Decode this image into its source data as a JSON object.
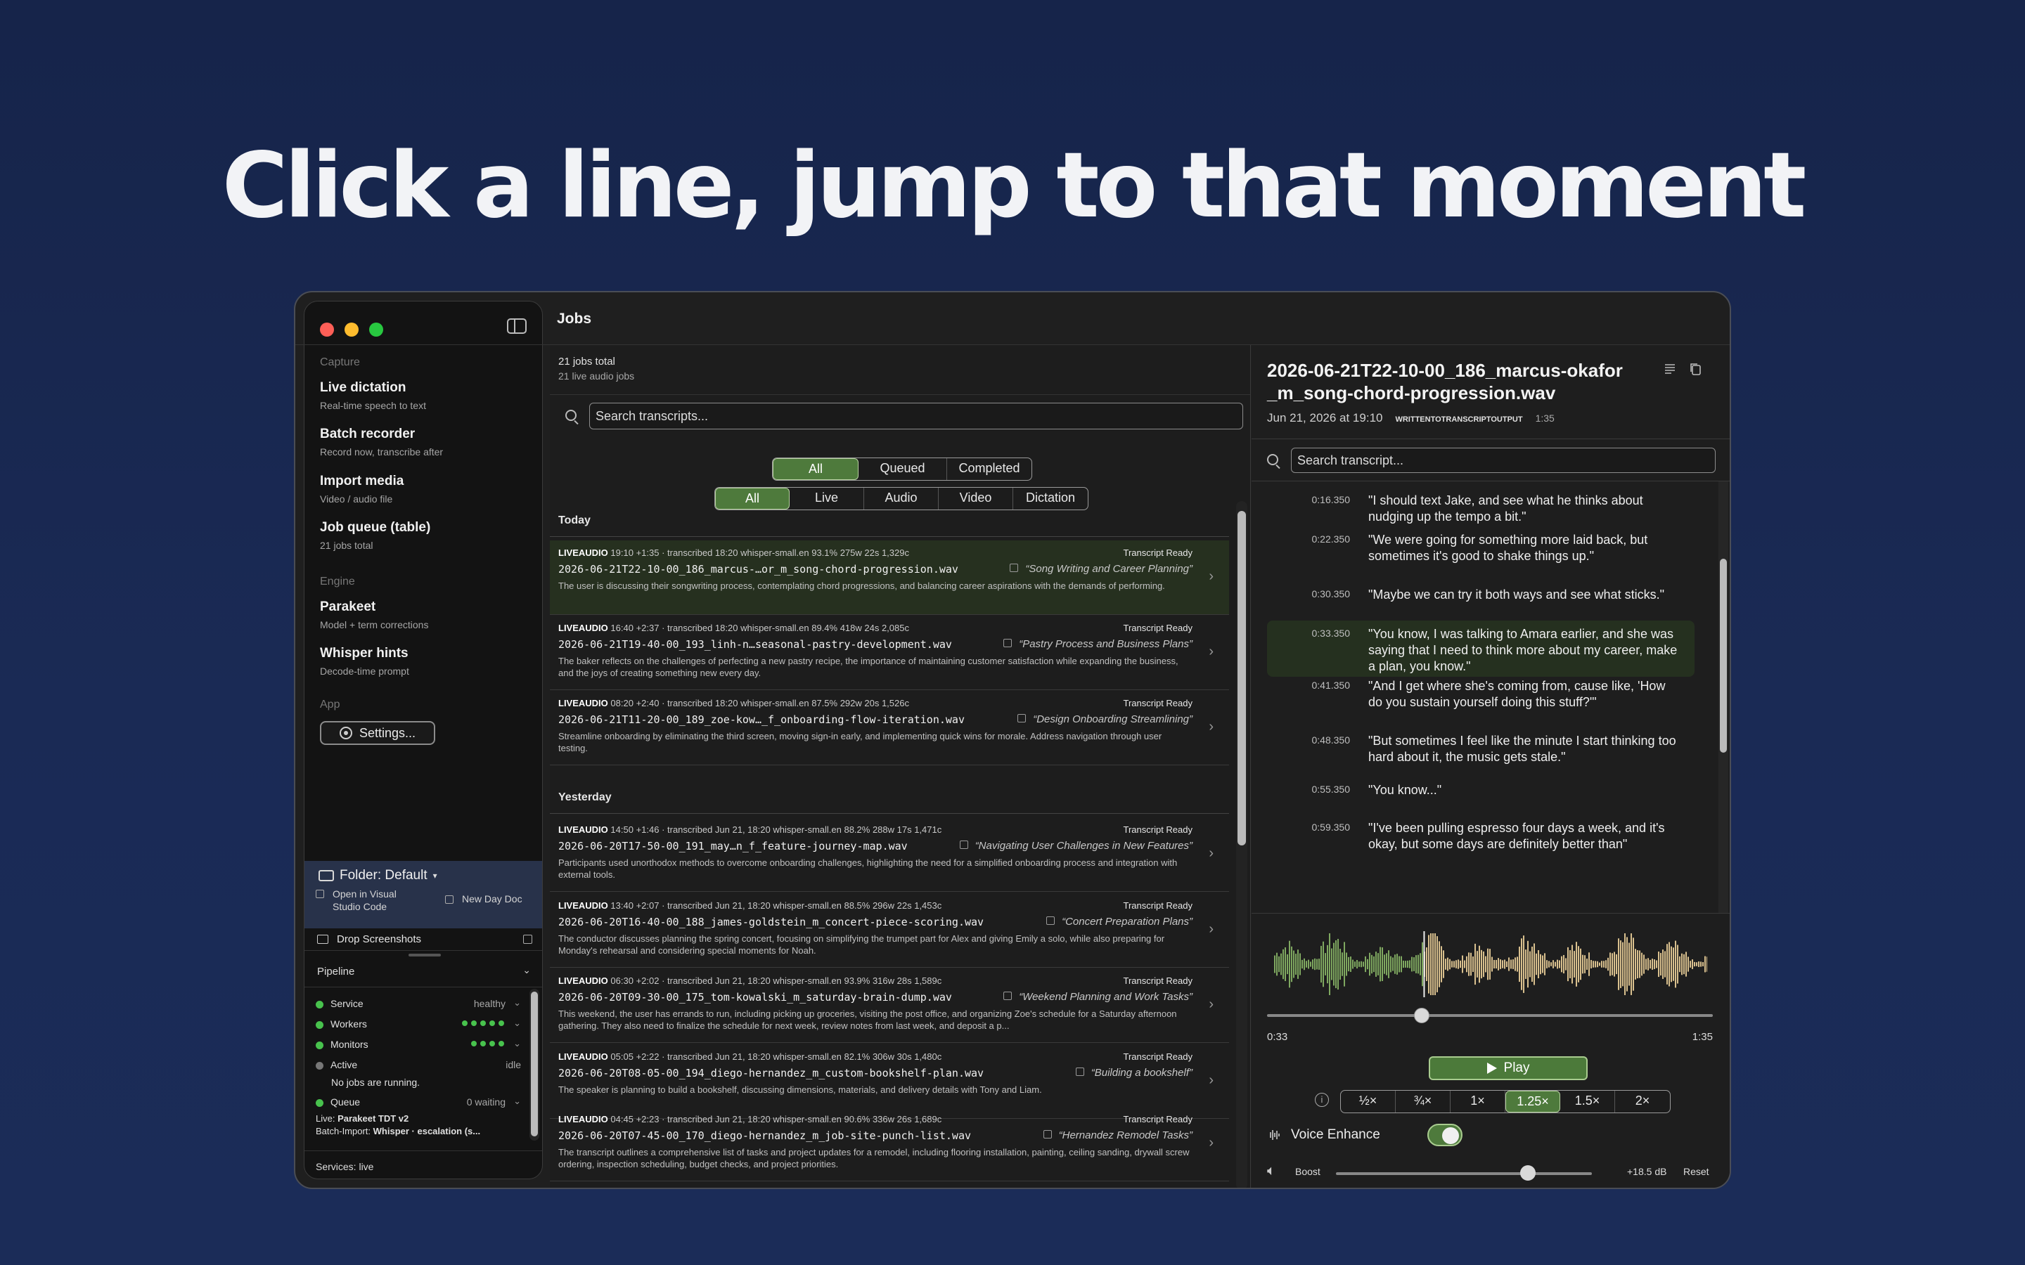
{
  "headline": "Click a line, jump to that moment",
  "sidebar": {
    "capture_head": "Capture",
    "items": [
      {
        "title": "Live dictation",
        "sub": "Real-time speech to text"
      },
      {
        "title": "Batch recorder",
        "sub": "Record now, transcribe after"
      },
      {
        "title": "Import media",
        "sub": "Video / audio file"
      },
      {
        "title": "Job queue (table)",
        "sub": "21 jobs total"
      },
      {
        "title": "Parakeet",
        "sub": "Model + term corrections"
      },
      {
        "title": "Whisper hints",
        "sub": "Decode-time prompt"
      }
    ],
    "engine_head": "Engine",
    "app_head": "App",
    "settings_label": "Settings...",
    "folder_label": "Folder: Default",
    "open_vs_label": "Open in Visual Studio Code",
    "new_day_doc": "New Day Doc",
    "drop_screenshots": "Drop Screenshots",
    "pipeline_head": "Pipeline",
    "pipeline": {
      "service": {
        "label": "Service",
        "value": "healthy"
      },
      "workers": {
        "label": "Workers"
      },
      "monitors": {
        "label": "Monitors"
      },
      "active": {
        "label": "Active",
        "value": "idle",
        "note": "No jobs are running."
      },
      "queue": {
        "label": "Queue",
        "value": "0 waiting"
      },
      "live": {
        "label": "Live:",
        "value": "Parakeet TDT v2"
      },
      "batch": {
        "label": "Batch-Import:",
        "value": "Whisper · escalation (s..."
      }
    },
    "services": "Services: live"
  },
  "toolbar": {
    "title": "Jobs"
  },
  "jobs": {
    "total": "21 jobs total",
    "live_total": "21 live audio jobs",
    "search_placeholder": "Search transcripts...",
    "status_filters": [
      "All",
      "Queued",
      "Completed"
    ],
    "type_filters": [
      "All",
      "Live",
      "Audio",
      "Video",
      "Dictation"
    ],
    "today_label": "Today",
    "yesterday_label": "Yesterday",
    "today": [
      {
        "kind": "LIVEAUDIO",
        "meta": "19:10 +1:35 · transcribed 18:20  whisper-small.en  93.1%  275w  22s  1,329c",
        "status": "Transcript Ready",
        "file": "2026-06-21T22-10-00_186_marcus-…or_m_song-chord-progression.wav",
        "topic": "“Song Writing and Career Planning”",
        "desc": "The user is discussing their songwriting process, contemplating chord progressions, and balancing career aspirations with the demands of performing."
      },
      {
        "kind": "LIVEAUDIO",
        "meta": "16:40 +2:37 · transcribed 18:20  whisper-small.en  89.4%  418w  24s  2,085c",
        "status": "Transcript Ready",
        "file": "2026-06-21T19-40-00_193_linh-n…seasonal-pastry-development.wav",
        "topic": "“Pastry Process and Business Plans”",
        "desc": "The baker reflects on the challenges of perfecting a new pastry recipe, the importance of maintaining customer satisfaction while expanding the business, and the joys of creating something new every day."
      },
      {
        "kind": "LIVEAUDIO",
        "meta": "08:20 +2:40 · transcribed 18:20  whisper-small.en  87.5%  292w  20s  1,526c",
        "status": "Transcript Ready",
        "file": "2026-06-21T11-20-00_189_zoe-kow…_f_onboarding-flow-iteration.wav",
        "topic": "“Design Onboarding Streamlining”",
        "desc": "Streamline onboarding by eliminating the third screen, moving sign-in early, and implementing quick wins for morale. Address navigation through user testing."
      }
    ],
    "yesterday": [
      {
        "kind": "LIVEAUDIO",
        "meta": "14:50 +1:46 · transcribed Jun 21, 18:20  whisper-small.en  88.2%  288w  17s  1,471c",
        "status": "Transcript Ready",
        "file": "2026-06-20T17-50-00_191_may…n_f_feature-journey-map.wav",
        "topic": "“Navigating User Challenges in New Features”",
        "desc": "Participants used unorthodox methods to overcome onboarding challenges, highlighting the need for a simplified onboarding process and integration with external tools."
      },
      {
        "kind": "LIVEAUDIO",
        "meta": "13:40 +2:07 · transcribed Jun 21, 18:20  whisper-small.en  88.5%  296w  22s  1,453c",
        "status": "Transcript Ready",
        "file": "2026-06-20T16-40-00_188_james-goldstein_m_concert-piece-scoring.wav",
        "topic": "“Concert Preparation Plans”",
        "desc": "The conductor discusses planning the spring concert, focusing on simplifying the trumpet part for Alex and giving Emily a solo, while also preparing for Monday's rehearsal and considering special moments for Noah."
      },
      {
        "kind": "LIVEAUDIO",
        "meta": "06:30 +2:02 · transcribed Jun 21, 18:20  whisper-small.en  93.9%  316w  28s  1,589c",
        "status": "Transcript Ready",
        "file": "2026-06-20T09-30-00_175_tom-kowalski_m_saturday-brain-dump.wav",
        "topic": "“Weekend Planning and Work Tasks”",
        "desc": "This weekend, the user has errands to run, including picking up groceries, visiting the post office, and organizing Zoe's schedule for a Saturday afternoon gathering. They also need to finalize the schedule for next week, review notes from last week, and deposit a p..."
      },
      {
        "kind": "LIVEAUDIO",
        "meta": "05:05 +2:22 · transcribed Jun 21, 18:20  whisper-small.en  82.1%  306w  30s  1,480c",
        "status": "Transcript Ready",
        "file": "2026-06-20T08-05-00_194_diego-hernandez_m_custom-bookshelf-plan.wav",
        "topic": "“Building a bookshelf”",
        "desc": "The speaker is planning to build a bookshelf, discussing dimensions, materials, and delivery details with Tony and Liam."
      },
      {
        "kind": "LIVEAUDIO",
        "meta": "04:45 +2:23 · transcribed Jun 21, 18:20  whisper-small.en  90.6%  336w  26s  1,689c",
        "status": "Transcript Ready",
        "file": "2026-06-20T07-45-00_170_diego-hernandez_m_job-site-punch-list.wav",
        "topic": "“Hernandez Remodel Tasks”",
        "desc": "The transcript outlines a comprehensive list of tasks and project updates for a remodel, including flooring installation, painting, ceiling sanding, drywall screw ordering, inspection scheduling, budget checks, and project priorities."
      }
    ]
  },
  "detail": {
    "title": "2026-06-21T22-10-00_186_marcus-okafor_m_song-chord-progression.wav",
    "date": "Jun 21, 2026 at 19:10",
    "tag": "WRITTENTOTRANSCRIPTOUTPUT",
    "duration": "1:35",
    "search_placeholder": "Search transcript...",
    "lines": [
      {
        "ts": "0:16.350",
        "text": "\"I should text Jake, and see what he thinks about nudging up the tempo a bit.\""
      },
      {
        "ts": "0:22.350",
        "text": "\"We were going for something more laid back, but sometimes it's good to shake things up.\""
      },
      {
        "ts": "0:30.350",
        "text": "\"Maybe we can try it both ways and see what sticks.\""
      },
      {
        "ts": "0:33.350",
        "text": "\"You know, I was talking to Amara earlier, and she was saying that I need to think more about my career, make a plan, you know.\""
      },
      {
        "ts": "0:41.350",
        "text": "\"And I get where she's coming from, cause like, 'How do you sustain yourself doing this stuff?'\""
      },
      {
        "ts": "0:48.350",
        "text": "\"But sometimes I feel like the minute I start thinking too hard about it, the music gets stale.\""
      },
      {
        "ts": "0:55.350",
        "text": "\"You know...\""
      },
      {
        "ts": "0:59.350",
        "text": "\"I've been pulling espresso four days a week, and it's okay, but some days are definitely better than\""
      }
    ],
    "current_line": 3,
    "playback": {
      "current": "0:33",
      "end": "1:35",
      "progress": 0.347,
      "play_label": "Play",
      "speeds": [
        "½×",
        "¾×",
        "1×",
        "1.25×",
        "1.5×",
        "2×"
      ],
      "speed_selected": "1.25×",
      "voice_enhance": "Voice Enhance",
      "voice_enhance_on": true,
      "boost_label": "Boost",
      "boost_db": "+18.5 dB",
      "boost_level": 0.75,
      "reset_label": "Reset"
    }
  },
  "colors": {
    "accent": "#4e7a3c",
    "selected_row": "#26301f",
    "status_green": "#48c24d",
    "wave_played": "#7fa860",
    "wave_unplayed": "#d9c08e"
  }
}
